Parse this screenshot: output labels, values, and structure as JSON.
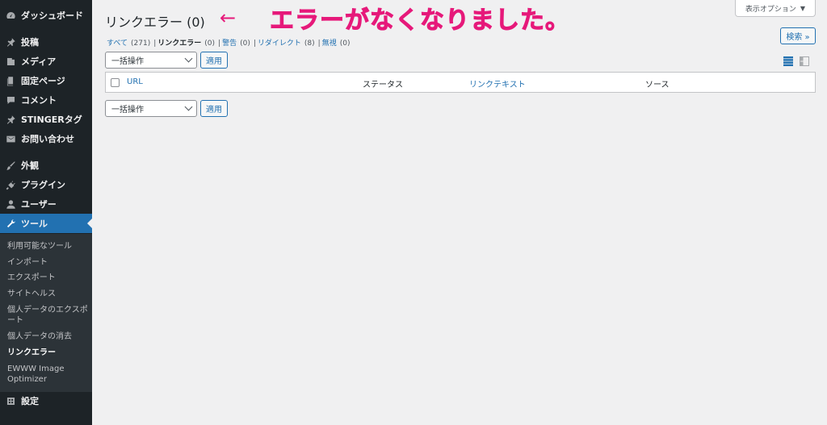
{
  "sidebar": {
    "items": [
      {
        "label": "ダッシュボード",
        "icon": "dashboard-icon"
      },
      {
        "label": "投稿",
        "icon": "pin-icon"
      },
      {
        "label": "メディア",
        "icon": "media-icon"
      },
      {
        "label": "固定ページ",
        "icon": "page-icon"
      },
      {
        "label": "コメント",
        "icon": "comment-icon"
      },
      {
        "label": "STINGERタグ",
        "icon": "pin-icon"
      },
      {
        "label": "お問い合わせ",
        "icon": "mail-icon"
      },
      {
        "label": "外観",
        "icon": "brush-icon"
      },
      {
        "label": "プラグイン",
        "icon": "plugin-icon"
      },
      {
        "label": "ユーザー",
        "icon": "user-icon"
      },
      {
        "label": "ツール",
        "icon": "wrench-icon"
      },
      {
        "label": "設定",
        "icon": "settings-icon"
      }
    ],
    "submenu": [
      "利用可能なツール",
      "インポート",
      "エクスポート",
      "サイトヘルス",
      "個人データのエクスポート",
      "個人データの消去",
      "リンクエラー",
      "EWWW Image Optimizer"
    ]
  },
  "header": {
    "title": "リンクエラー (0)",
    "arrow": "←",
    "annotation": "エラーがなくなりました。",
    "screen_options": "表示オプション",
    "search_button": "検索 »"
  },
  "filters": [
    {
      "label": "すべて",
      "count": "(271)"
    },
    {
      "label": "リンクエラー",
      "count": "(0)"
    },
    {
      "label": "警告",
      "count": "(0)"
    },
    {
      "label": "リダイレクト",
      "count": "(8)"
    },
    {
      "label": "無視",
      "count": "(0)"
    }
  ],
  "bulk": {
    "select_label": "一括操作",
    "apply_label": "適用"
  },
  "table": {
    "columns": [
      "URL",
      "ステータス",
      "リンクテキスト",
      "ソース"
    ]
  },
  "colors": {
    "accent": "#2271b1",
    "annotation": "#e6197a",
    "sidebar_bg": "#1d2327"
  }
}
